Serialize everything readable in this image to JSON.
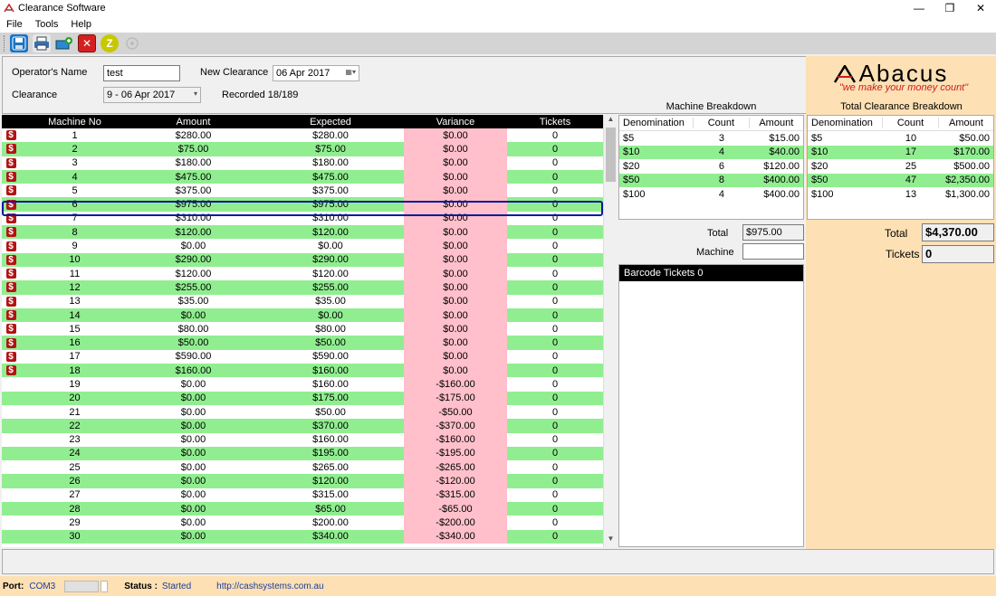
{
  "window": {
    "title": "Clearance Software"
  },
  "menu": [
    "File",
    "Tools",
    "Help"
  ],
  "toolbar": {
    "colors": {
      "save": "#1a73c7",
      "print": "#3a6fb0",
      "add": "#2a8ad0",
      "close": "#d42020",
      "z": "#c8c800"
    }
  },
  "form": {
    "operator_label": "Operator's Name",
    "operator_value": "test",
    "new_clearance_label": "New Clearance",
    "new_clearance_date": "06 Apr 2017",
    "clearance_label": "Clearance",
    "clearance_value": "9  -  06 Apr 2017",
    "recorded": "Recorded 18/189"
  },
  "grid": {
    "headers": [
      "Machine No",
      "Amount",
      "Expected",
      "Variance",
      "Tickets"
    ],
    "rows": [
      {
        "flag": true,
        "no": "1",
        "amount": "$280.00",
        "expected": "$280.00",
        "variance": "$0.00",
        "tickets": "0"
      },
      {
        "flag": true,
        "no": "2",
        "amount": "$75.00",
        "expected": "$75.00",
        "variance": "$0.00",
        "tickets": "0"
      },
      {
        "flag": true,
        "no": "3",
        "amount": "$180.00",
        "expected": "$180.00",
        "variance": "$0.00",
        "tickets": "0"
      },
      {
        "flag": true,
        "no": "4",
        "amount": "$475.00",
        "expected": "$475.00",
        "variance": "$0.00",
        "tickets": "0"
      },
      {
        "flag": true,
        "no": "5",
        "amount": "$375.00",
        "expected": "$375.00",
        "variance": "$0.00",
        "tickets": "0"
      },
      {
        "flag": true,
        "no": "6",
        "amount": "$975.00",
        "expected": "$975.00",
        "variance": "$0.00",
        "tickets": "0"
      },
      {
        "flag": true,
        "no": "7",
        "amount": "$310.00",
        "expected": "$310.00",
        "variance": "$0.00",
        "tickets": "0"
      },
      {
        "flag": true,
        "no": "8",
        "amount": "$120.00",
        "expected": "$120.00",
        "variance": "$0.00",
        "tickets": "0"
      },
      {
        "flag": true,
        "no": "9",
        "amount": "$0.00",
        "expected": "$0.00",
        "variance": "$0.00",
        "tickets": "0"
      },
      {
        "flag": true,
        "no": "10",
        "amount": "$290.00",
        "expected": "$290.00",
        "variance": "$0.00",
        "tickets": "0"
      },
      {
        "flag": true,
        "no": "11",
        "amount": "$120.00",
        "expected": "$120.00",
        "variance": "$0.00",
        "tickets": "0"
      },
      {
        "flag": true,
        "no": "12",
        "amount": "$255.00",
        "expected": "$255.00",
        "variance": "$0.00",
        "tickets": "0"
      },
      {
        "flag": true,
        "no": "13",
        "amount": "$35.00",
        "expected": "$35.00",
        "variance": "$0.00",
        "tickets": "0"
      },
      {
        "flag": true,
        "no": "14",
        "amount": "$0.00",
        "expected": "$0.00",
        "variance": "$0.00",
        "tickets": "0"
      },
      {
        "flag": true,
        "no": "15",
        "amount": "$80.00",
        "expected": "$80.00",
        "variance": "$0.00",
        "tickets": "0"
      },
      {
        "flag": true,
        "no": "16",
        "amount": "$50.00",
        "expected": "$50.00",
        "variance": "$0.00",
        "tickets": "0"
      },
      {
        "flag": true,
        "no": "17",
        "amount": "$590.00",
        "expected": "$590.00",
        "variance": "$0.00",
        "tickets": "0"
      },
      {
        "flag": true,
        "no": "18",
        "amount": "$160.00",
        "expected": "$160.00",
        "variance": "$0.00",
        "tickets": "0"
      },
      {
        "flag": false,
        "no": "19",
        "amount": "$0.00",
        "expected": "$160.00",
        "variance": "-$160.00",
        "tickets": "0"
      },
      {
        "flag": false,
        "no": "20",
        "amount": "$0.00",
        "expected": "$175.00",
        "variance": "-$175.00",
        "tickets": "0"
      },
      {
        "flag": false,
        "no": "21",
        "amount": "$0.00",
        "expected": "$50.00",
        "variance": "-$50.00",
        "tickets": "0"
      },
      {
        "flag": false,
        "no": "22",
        "amount": "$0.00",
        "expected": "$370.00",
        "variance": "-$370.00",
        "tickets": "0"
      },
      {
        "flag": false,
        "no": "23",
        "amount": "$0.00",
        "expected": "$160.00",
        "variance": "-$160.00",
        "tickets": "0"
      },
      {
        "flag": false,
        "no": "24",
        "amount": "$0.00",
        "expected": "$195.00",
        "variance": "-$195.00",
        "tickets": "0"
      },
      {
        "flag": false,
        "no": "25",
        "amount": "$0.00",
        "expected": "$265.00",
        "variance": "-$265.00",
        "tickets": "0"
      },
      {
        "flag": false,
        "no": "26",
        "amount": "$0.00",
        "expected": "$120.00",
        "variance": "-$120.00",
        "tickets": "0"
      },
      {
        "flag": false,
        "no": "27",
        "amount": "$0.00",
        "expected": "$315.00",
        "variance": "-$315.00",
        "tickets": "0"
      },
      {
        "flag": false,
        "no": "28",
        "amount": "$0.00",
        "expected": "$65.00",
        "variance": "-$65.00",
        "tickets": "0"
      },
      {
        "flag": false,
        "no": "29",
        "amount": "$0.00",
        "expected": "$200.00",
        "variance": "-$200.00",
        "tickets": "0"
      },
      {
        "flag": false,
        "no": "30",
        "amount": "$0.00",
        "expected": "$340.00",
        "variance": "-$340.00",
        "tickets": "0"
      }
    ]
  },
  "machine_breakdown": {
    "title": "Machine Breakdown",
    "headers": [
      "Denomination",
      "Count",
      "Amount"
    ],
    "rows": [
      {
        "denom": "$5",
        "count": "3",
        "amount": "$15.00"
      },
      {
        "denom": "$10",
        "count": "4",
        "amount": "$40.00"
      },
      {
        "denom": "$20",
        "count": "6",
        "amount": "$120.00"
      },
      {
        "denom": "$50",
        "count": "8",
        "amount": "$400.00"
      },
      {
        "denom": "$100",
        "count": "4",
        "amount": "$400.00"
      }
    ],
    "total_label": "Total",
    "total_value": "$975.00",
    "machine_label": "Machine",
    "machine_value": ""
  },
  "barcode": {
    "header": "Barcode Tickets 0"
  },
  "brand": {
    "name": "Abacus",
    "tagline": "\"we make your money count\""
  },
  "total_breakdown": {
    "title": "Total Clearance Breakdown",
    "headers": [
      "Denomination",
      "Count",
      "Amount"
    ],
    "rows": [
      {
        "denom": "$5",
        "count": "10",
        "amount": "$50.00"
      },
      {
        "denom": "$10",
        "count": "17",
        "amount": "$170.00"
      },
      {
        "denom": "$20",
        "count": "25",
        "amount": "$500.00"
      },
      {
        "denom": "$50",
        "count": "47",
        "amount": "$2,350.00"
      },
      {
        "denom": "$100",
        "count": "13",
        "amount": "$1,300.00"
      }
    ],
    "total_label": "Total",
    "total_value": "$4,370.00",
    "tickets_label": "Tickets",
    "tickets_value": "0"
  },
  "status": {
    "port_label": "Port:",
    "port_value": "COM3",
    "status_label": "Status :",
    "status_value": "Started",
    "url": "http://cashsystems.com.au"
  }
}
